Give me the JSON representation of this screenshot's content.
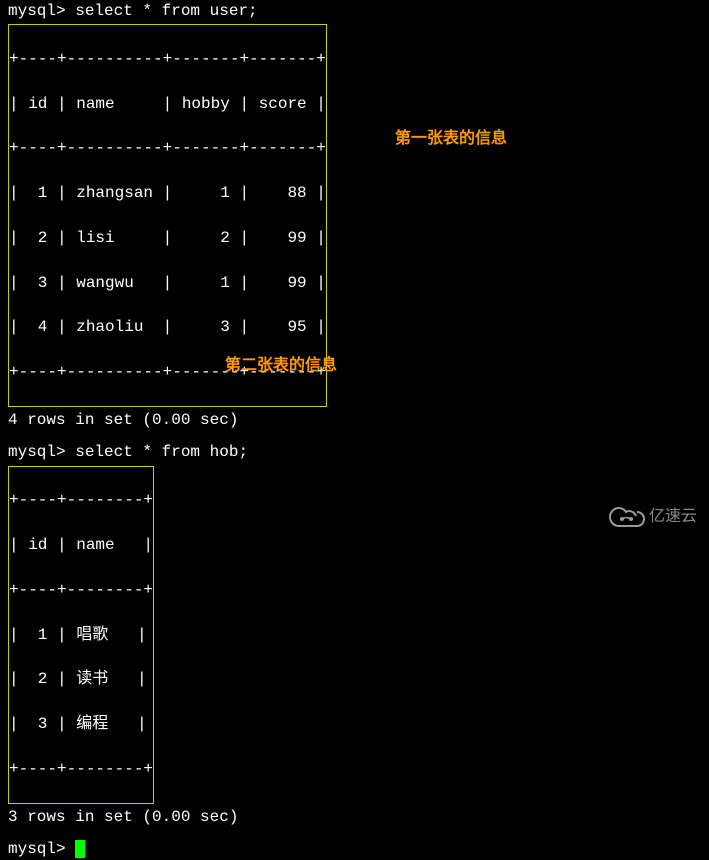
{
  "query1": {
    "prompt": "mysql>",
    "command": " select * from user;",
    "border": "+----+----------+-------+-------+",
    "header": "| id | name     | hobby | score |",
    "rows": [
      "|  1 | zhangsan |     1 |    88 |",
      "|  2 | lisi     |     2 |    99 |",
      "|  3 | wangwu   |     1 |    99 |",
      "|  4 | zhaoliu  |     3 |    95 |"
    ],
    "result": "4 rows in set (0.00 sec)",
    "annotation": "第一张表的信息"
  },
  "query2": {
    "prompt": "mysql>",
    "command": " select * from hob;",
    "border": "+----+--------+",
    "header": "| id | name   |",
    "rows": [
      "|  1 | 唱歌   |",
      "|  2 | 读书   |",
      "|  3 | 编程   |"
    ],
    "result": "3 rows in set (0.00 sec)",
    "annotation": "第二张表的信息"
  },
  "prompt3": "mysql> ",
  "logo_text": "亿速云",
  "chart_data": [
    {
      "type": "table",
      "title": "user",
      "columns": [
        "id",
        "name",
        "hobby",
        "score"
      ],
      "rows": [
        [
          1,
          "zhangsan",
          1,
          88
        ],
        [
          2,
          "lisi",
          2,
          99
        ],
        [
          3,
          "wangwu",
          1,
          99
        ],
        [
          4,
          "zhaoliu",
          3,
          95
        ]
      ]
    },
    {
      "type": "table",
      "title": "hob",
      "columns": [
        "id",
        "name"
      ],
      "rows": [
        [
          1,
          "唱歌"
        ],
        [
          2,
          "读书"
        ],
        [
          3,
          "编程"
        ]
      ]
    }
  ]
}
